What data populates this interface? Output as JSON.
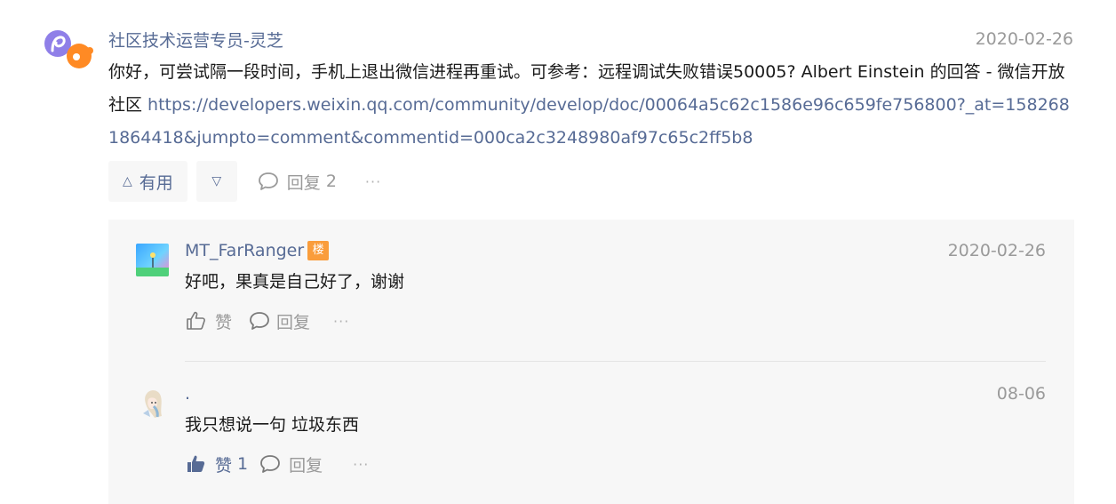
{
  "colors": {
    "link": "#576b95",
    "meta": "#9a9a9a",
    "text": "#1a1a1a",
    "panel": "#f7f7f7",
    "badge": "#fa9d3b"
  },
  "comment": {
    "author": "社区技术运营专员-灵芝",
    "date": "2020-02-26",
    "text": "你好，可尝试隔一段时间，手机上退出微信进程再重试。可参考：远程调试失败错误50005? Albert Einstein  的回答 - 微信开放社区 ",
    "link": "https://developers.weixin.qq.com/community/develop/doc/00064a5c62c1586e96c659fe756800?_at=1582681864418&jumpto=comment&commentid=000ca2c3248980af97c65c2ff5b8",
    "avatar_icon": "weixin-community-logo-icon",
    "actions": {
      "useful_label": "有用",
      "useful_icon": "triangle-up-icon",
      "not_useful_icon": "triangle-down-icon",
      "reply_label": "回复",
      "reply_count": "2",
      "more": "···"
    }
  },
  "replies": [
    {
      "author": "MT_FarRanger",
      "badge": "楼",
      "date": "2020-02-26",
      "text": "好吧，果真是自己好了，谢谢",
      "like_label": "赞",
      "like_count": "",
      "reply_label": "回复",
      "more": "···",
      "avatar_icon": "landscape-avatar-icon"
    },
    {
      "author": ".",
      "date": "08-06",
      "text": "我只想说一句 垃圾东西",
      "like_label": "赞",
      "like_count": "1",
      "reply_label": "回复",
      "more": "···",
      "avatar_icon": "anime-avatar-icon"
    }
  ]
}
